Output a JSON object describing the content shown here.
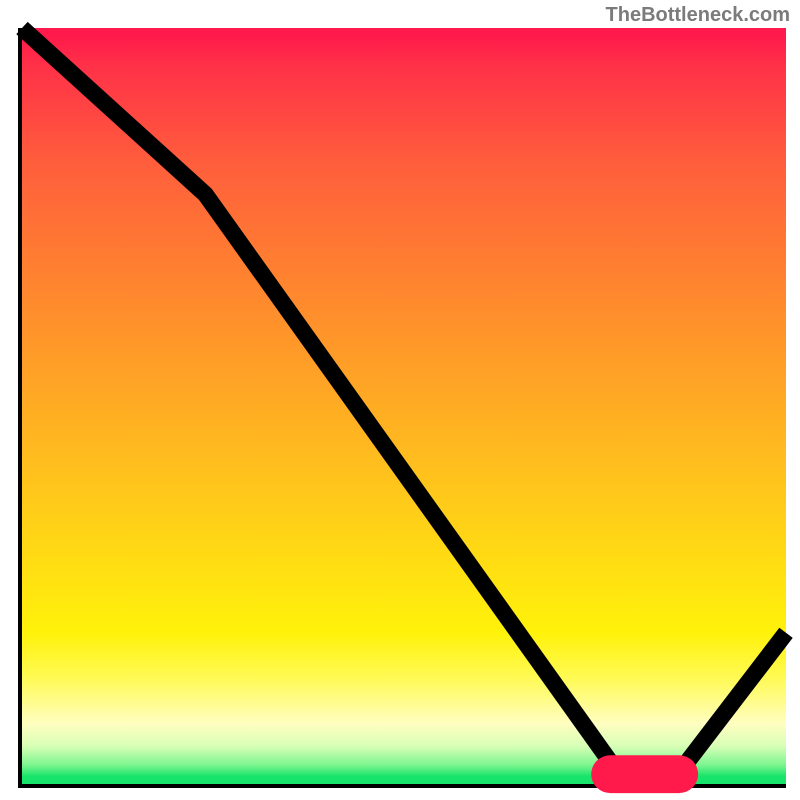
{
  "source_label": "TheBottleneck.com",
  "chart_data": {
    "type": "line",
    "title": "",
    "xlabel": "",
    "ylabel": "",
    "xlim": [
      0,
      100
    ],
    "ylim": [
      0,
      100
    ],
    "series": [
      {
        "name": "bottleneck-curve",
        "x": [
          0,
          24,
          78,
          86,
          100
        ],
        "values": [
          100,
          78,
          1.5,
          1.5,
          20
        ]
      }
    ],
    "optimum_marker": {
      "x_start": 77,
      "x_end": 86,
      "y": 1.3
    },
    "gradient_stops": [
      {
        "pos": 0,
        "color": "#ff1a4b"
      },
      {
        "pos": 5,
        "color": "#ff3148"
      },
      {
        "pos": 18,
        "color": "#ff5e3c"
      },
      {
        "pos": 32,
        "color": "#ff8030"
      },
      {
        "pos": 46,
        "color": "#ffa226"
      },
      {
        "pos": 60,
        "color": "#ffc41c"
      },
      {
        "pos": 72,
        "color": "#ffe012"
      },
      {
        "pos": 80,
        "color": "#fff20a"
      },
      {
        "pos": 86,
        "color": "#fffa55"
      },
      {
        "pos": 92,
        "color": "#fffec0"
      },
      {
        "pos": 95,
        "color": "#d8ffb7"
      },
      {
        "pos": 97.5,
        "color": "#7cf58f"
      },
      {
        "pos": 99,
        "color": "#17e46a"
      },
      {
        "pos": 100,
        "color": "#17e46a"
      }
    ]
  }
}
